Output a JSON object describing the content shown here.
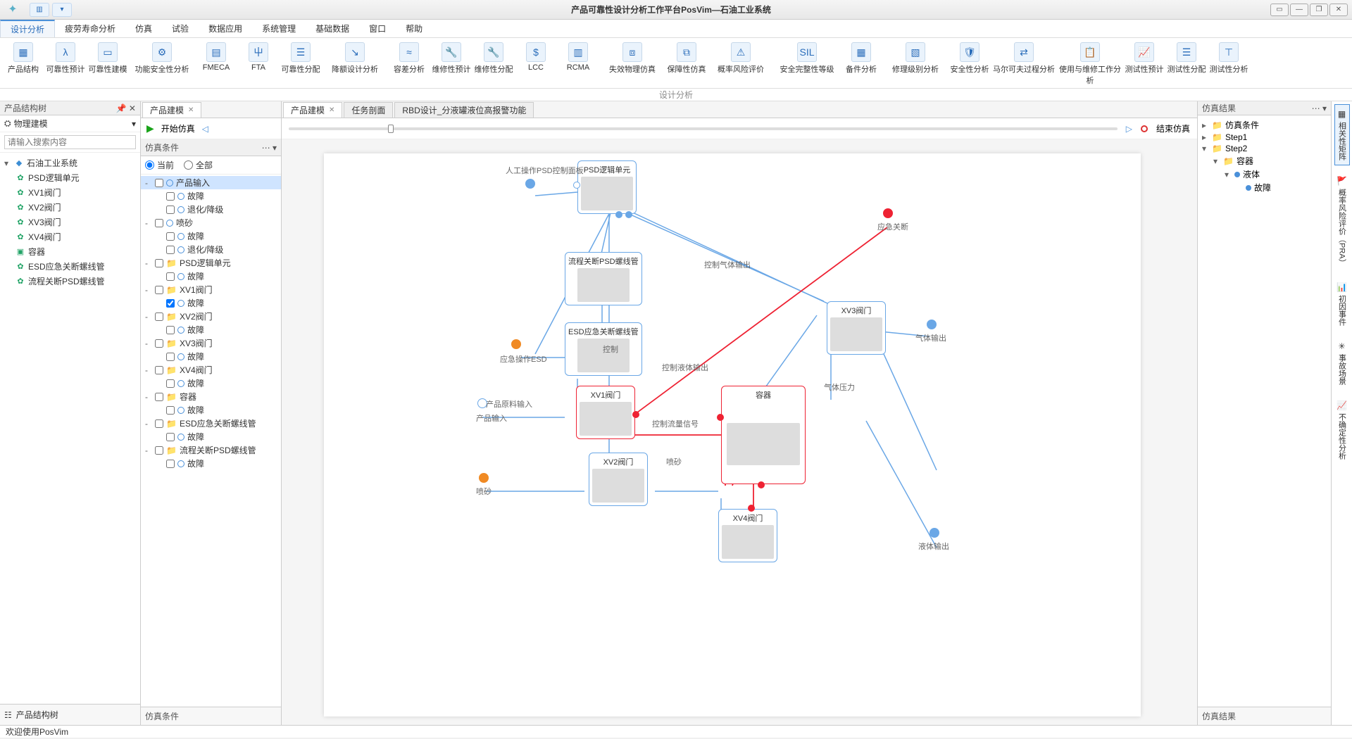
{
  "app": {
    "title": "产品可靠性设计分析工作平台PosVim—石油工业系统",
    "status": "欢迎使用PosVim"
  },
  "menu": {
    "tabs": [
      "设计分析",
      "疲劳寿命分析",
      "仿真",
      "试验",
      "数据应用",
      "系统管理",
      "基础数据",
      "窗口",
      "帮助"
    ],
    "active": "设计分析",
    "group_label": "设计分析"
  },
  "ribbon": [
    {
      "label": "产品结构",
      "icon": "▦"
    },
    {
      "label": "可靠性预计",
      "icon": "λ"
    },
    {
      "label": "可靠性建模",
      "icon": "▭"
    },
    {
      "label": "功能安全性分析",
      "icon": "⚙"
    },
    {
      "label": "FMECA",
      "icon": "▤"
    },
    {
      "label": "FTA",
      "icon": "⼬"
    },
    {
      "label": "可靠性分配",
      "icon": "☰"
    },
    {
      "label": "降额设计分析",
      "icon": "↘"
    },
    {
      "label": "容差分析",
      "icon": "≈"
    },
    {
      "label": "维修性预计",
      "icon": "🔧"
    },
    {
      "label": "维修性分配",
      "icon": "🔧"
    },
    {
      "label": "LCC",
      "icon": "$"
    },
    {
      "label": "RCMA",
      "icon": "▥"
    },
    {
      "label": "失效物理仿真",
      "icon": "⧈"
    },
    {
      "label": "保障性仿真",
      "icon": "⧉"
    },
    {
      "label": "概率风险评价",
      "icon": "⚠"
    },
    {
      "label": "安全完整性等级",
      "icon": "SIL"
    },
    {
      "label": "备件分析",
      "icon": "▦"
    },
    {
      "label": "修理级别分析",
      "icon": "▧"
    },
    {
      "label": "安全性分析",
      "icon": "🛡"
    },
    {
      "label": "马尔可夫过程分析",
      "icon": "⇄"
    },
    {
      "label": "使用与维修工作分析",
      "icon": "📋"
    },
    {
      "label": "测试性预计",
      "icon": "📈"
    },
    {
      "label": "测试性分配",
      "icon": "☰"
    },
    {
      "label": "测试性分析",
      "icon": "⊤"
    }
  ],
  "left": {
    "title": "产品结构树",
    "mode": "物理建模",
    "search_placeholder": "请输入搜索内容",
    "footer": "产品结构树",
    "root": "石油工业系统",
    "items": [
      {
        "label": "PSD逻辑单元",
        "icon": "gear"
      },
      {
        "label": "XV1阀门",
        "icon": "gear"
      },
      {
        "label": "XV2阀门",
        "icon": "gear"
      },
      {
        "label": "XV3阀门",
        "icon": "gear"
      },
      {
        "label": "XV4阀门",
        "icon": "gear"
      },
      {
        "label": "容器",
        "icon": "box"
      },
      {
        "label": "ESD应急关断螺线管",
        "icon": "gear"
      },
      {
        "label": "流程关断PSD螺线管",
        "icon": "gear"
      }
    ]
  },
  "doc_tabs": [
    {
      "label": "产品建模",
      "closable": true,
      "active": true
    },
    {
      "label": "任务剖面",
      "closable": false,
      "active": false
    },
    {
      "label": "RBD设计_分液罐液位高报警功能",
      "closable": false,
      "active": false
    }
  ],
  "sim": {
    "start": "开始仿真",
    "end": "结束仿真"
  },
  "cond": {
    "title": "仿真条件",
    "footer": "仿真条件",
    "filter_current": "当前",
    "filter_all": "全部",
    "tree": [
      {
        "l": 1,
        "fold": "-",
        "chk": false,
        "type": "circle",
        "label": "产品输入",
        "sel": true
      },
      {
        "l": 2,
        "fold": "",
        "chk": false,
        "type": "circle",
        "label": "故障"
      },
      {
        "l": 2,
        "fold": "",
        "chk": false,
        "type": "circle",
        "label": "退化/降级"
      },
      {
        "l": 1,
        "fold": "-",
        "chk": false,
        "type": "circle",
        "label": "喷砂"
      },
      {
        "l": 2,
        "fold": "",
        "chk": false,
        "type": "circle",
        "label": "故障"
      },
      {
        "l": 2,
        "fold": "",
        "chk": false,
        "type": "circle",
        "label": "退化/降级"
      },
      {
        "l": 1,
        "fold": "-",
        "chk": false,
        "type": "folder",
        "label": "PSD逻辑单元"
      },
      {
        "l": 2,
        "fold": "",
        "chk": false,
        "type": "circle",
        "label": "故障"
      },
      {
        "l": 1,
        "fold": "-",
        "chk": false,
        "type": "folder",
        "label": "XV1阀门"
      },
      {
        "l": 2,
        "fold": "",
        "chk": true,
        "type": "circle",
        "label": "故障"
      },
      {
        "l": 1,
        "fold": "-",
        "chk": false,
        "type": "folder",
        "label": "XV2阀门"
      },
      {
        "l": 2,
        "fold": "",
        "chk": false,
        "type": "circle",
        "label": "故障"
      },
      {
        "l": 1,
        "fold": "-",
        "chk": false,
        "type": "folder",
        "label": "XV3阀门"
      },
      {
        "l": 2,
        "fold": "",
        "chk": false,
        "type": "circle",
        "label": "故障"
      },
      {
        "l": 1,
        "fold": "-",
        "chk": false,
        "type": "folder",
        "label": "XV4阀门"
      },
      {
        "l": 2,
        "fold": "",
        "chk": false,
        "type": "circle",
        "label": "故障"
      },
      {
        "l": 1,
        "fold": "-",
        "chk": false,
        "type": "folder",
        "label": "容器"
      },
      {
        "l": 2,
        "fold": "",
        "chk": false,
        "type": "circle",
        "label": "故障"
      },
      {
        "l": 1,
        "fold": "-",
        "chk": false,
        "type": "folder",
        "label": "ESD应急关断螺线管"
      },
      {
        "l": 2,
        "fold": "",
        "chk": false,
        "type": "circle",
        "label": "故障"
      },
      {
        "l": 1,
        "fold": "-",
        "chk": false,
        "type": "folder",
        "label": "流程关断PSD螺线管"
      },
      {
        "l": 2,
        "fold": "",
        "chk": false,
        "type": "circle",
        "label": "故障"
      }
    ]
  },
  "diagram": {
    "nodes": {
      "psd": {
        "label": "PSD逻辑单元"
      },
      "panel": {
        "label": "人工操作PSD控制面板"
      },
      "psdline": {
        "label": "流程关断PSD螺线管"
      },
      "esd": {
        "label": "ESD应急关断螺线管"
      },
      "esdop": {
        "label": "应急操作ESD"
      },
      "xv1": {
        "label": "XV1阀门"
      },
      "xv2": {
        "label": "XV2阀门"
      },
      "xv3": {
        "label": "XV3阀门"
      },
      "xv4": {
        "label": "XV4阀门"
      },
      "vessel": {
        "label": "容器"
      },
      "input": {
        "label": "产品输入"
      },
      "rawin": {
        "label": "产品原料输入"
      },
      "sand": {
        "label": "喷砂"
      },
      "emerg": {
        "label": "应急关断"
      },
      "gasout": {
        "label": "气体输出"
      },
      "liqout": {
        "label": "液体输出"
      }
    },
    "edges": {
      "ctrl_gas": "控制气体输出",
      "ctrl": "控制",
      "ctrl_liq": "控制液体输出",
      "ctrl_flow": "控制流量信号",
      "gas_p": "气体压力",
      "sand2": "喷砂"
    }
  },
  "right": {
    "title": "仿真结果",
    "footer": "仿真结果",
    "items": [
      {
        "l": 1,
        "exp": "▸",
        "type": "folder",
        "label": "仿真条件"
      },
      {
        "l": 1,
        "exp": "▸",
        "type": "folder",
        "label": "Step1"
      },
      {
        "l": 1,
        "exp": "▾",
        "type": "folder",
        "label": "Step2"
      },
      {
        "l": 2,
        "exp": "▾",
        "type": "folder",
        "label": "容器"
      },
      {
        "l": 3,
        "exp": "▾",
        "type": "dot",
        "label": "液体"
      },
      {
        "l": 4,
        "exp": "",
        "type": "dot",
        "label": "故障"
      }
    ]
  },
  "side_tabs": [
    {
      "label": "相关性矩阵",
      "icon": "▦"
    },
    {
      "label": "概率风险评价（PRA）",
      "icon": "🚩"
    },
    {
      "label": "初因事件",
      "icon": "📊"
    },
    {
      "label": "事故场景",
      "icon": "✳"
    },
    {
      "label": "不确定性分析",
      "icon": "📈"
    }
  ]
}
